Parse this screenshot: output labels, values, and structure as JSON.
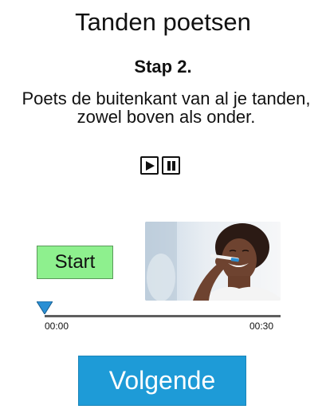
{
  "header": {
    "title": "Tanden poetsen"
  },
  "step": {
    "label": "Stap 2.",
    "instruction": "Poets de buitenkant van al je tanden, zowel boven als onder."
  },
  "media_controls": {
    "play_icon": "play-icon",
    "pause_icon": "pause-icon"
  },
  "timer": {
    "start_label": "Start",
    "time_start": "00:00",
    "time_end": "00:30",
    "progress": 0
  },
  "image": {
    "subject": "woman brushing teeth photo"
  },
  "footer": {
    "next_label": "Volgende",
    "accent_color": "#1e9bd7",
    "start_color": "#8ef08e"
  }
}
